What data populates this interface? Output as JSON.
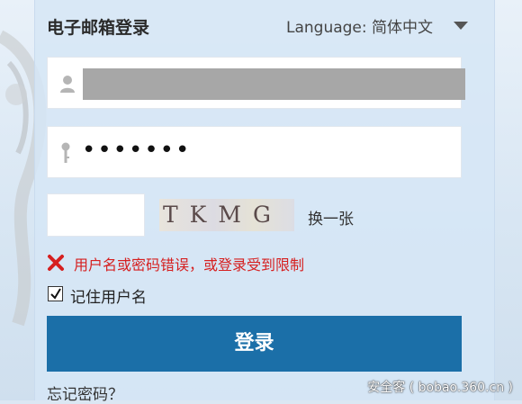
{
  "title": "电子邮箱登录",
  "language": {
    "label": "Language:",
    "selected": "简体中文"
  },
  "username": {
    "value": ""
  },
  "password": {
    "masked_value": "•••••••"
  },
  "captcha": {
    "text": "TKMG",
    "refresh_label": "换一张"
  },
  "error": {
    "message": "用户名或密码错误，或登录受到限制",
    "color": "#d62020"
  },
  "remember": {
    "checked": true,
    "label": "记住用户名"
  },
  "login_button": {
    "label": "登录",
    "color": "#1b6fa8"
  },
  "forgot_password": {
    "label": "忘记密码？"
  },
  "watermark": {
    "text": "安全客 ( bobao.360.cn )"
  }
}
